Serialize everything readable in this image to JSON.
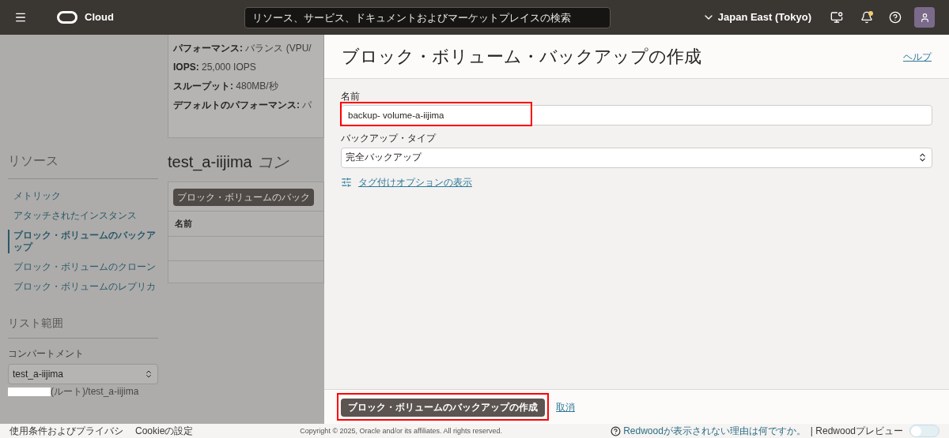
{
  "header": {
    "app_name": "Cloud",
    "search": {
      "placeholder": "リソース、サービス、ドキュメントおよびマーケットプレイスの検索"
    },
    "region": "Japan East (Tokyo)",
    "notifications_unread": true
  },
  "details": [
    {
      "label": "パフォーマンス:",
      "value": "バランス (VPU/"
    },
    {
      "label": "IOPS:",
      "value": "25,000 IOPS"
    },
    {
      "label": "スループット:",
      "value": "480MB/秒"
    },
    {
      "label": "デフォルトのパフォーマンス:",
      "value": "パ"
    }
  ],
  "sidebar": {
    "title": "リソース",
    "items": [
      {
        "label": "メトリック",
        "selected": false
      },
      {
        "label": "アタッチされたインスタンス",
        "selected": false
      },
      {
        "label": "ブロック・ボリュームのバックアップ",
        "selected": true
      },
      {
        "label": "ブロック・ボリュームのクローン",
        "selected": false
      },
      {
        "label": "ブロック・ボリュームのレプリカ",
        "selected": false
      }
    ],
    "scope_title": "リスト範囲",
    "compartment": {
      "label": "コンパートメント",
      "value": "test_a-iijima",
      "path": "(ルート)/test_a-iijima"
    }
  },
  "main": {
    "heading": "test_a-iijima",
    "heading_suffix": "コン",
    "table": {
      "button": "ブロック・ボリュームのバック",
      "columns": [
        "名前"
      ]
    }
  },
  "panel": {
    "title": "ブロック・ボリューム・バックアップの作成",
    "help": "ヘルプ",
    "fields": [
      {
        "kind": "text",
        "label": "名前",
        "value": "backup- volume-a-iijima",
        "highlighted": true
      },
      {
        "kind": "select",
        "label": "バックアップ・タイプ",
        "value": "完全バックアップ",
        "highlighted": false
      }
    ],
    "tag_link": "タグ付けオプションの表示",
    "primary": {
      "label": "ブロック・ボリュームのバックアップの作成",
      "highlighted": true
    },
    "cancel": "取消"
  },
  "footer": {
    "links": [
      "使用条件およびプライバシ",
      "Cookieの設定"
    ],
    "copyright": "Copyright © 2025, Oracle and/or its affiliates. All rights reserved.",
    "redwood_question": "Redwoodが表示されない理由は何ですか。",
    "redwood_preview": {
      "label": "| Redwoodプレビュー",
      "on": false
    }
  }
}
